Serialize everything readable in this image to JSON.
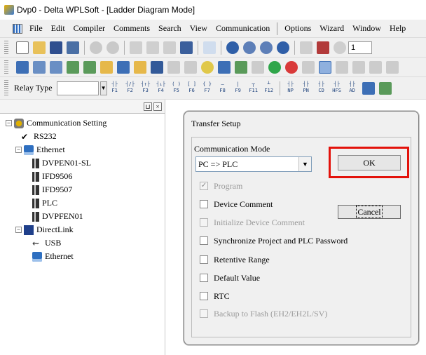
{
  "window": {
    "title": "Dvp0 - Delta WPLSoft - [Ladder Diagram Mode]"
  },
  "menu": [
    "File",
    "Edit",
    "Compiler",
    "Comments",
    "Search",
    "View",
    "Communication",
    "Options",
    "Wizard",
    "Window",
    "Help"
  ],
  "toolbar": {
    "step_value": "1",
    "relay_label": "Relay Type",
    "relay_value": ""
  },
  "function_keys": [
    "F1",
    "F2",
    "F3",
    "F4",
    "F5",
    "F6",
    "F7",
    "F8",
    "F9",
    "F11",
    "F12",
    "NP",
    "PN",
    "CD",
    "HFS",
    "AD"
  ],
  "tree": {
    "root": "Communication Setting",
    "rs232": "RS232",
    "ethernet": "Ethernet",
    "eth_devices": [
      "DVPEN01-SL",
      "IFD9506",
      "IFD9507",
      "PLC",
      "DVPFEN01"
    ],
    "directlink": "DirectLink",
    "usb": "USB",
    "dl_ethernet": "Ethernet"
  },
  "dialog": {
    "title": "Transfer Setup",
    "comm_mode_label": "Communication Mode",
    "comm_mode_value": "PC => PLC",
    "ok_label": "OK",
    "cancel_label": "Cancel",
    "options": [
      {
        "label": "Program",
        "checked": true,
        "enabled": false
      },
      {
        "label": "Device Comment",
        "checked": false,
        "enabled": true
      },
      {
        "label": "Initialize Device Comment",
        "checked": false,
        "enabled": false
      },
      {
        "label": "Synchronize Project and PLC Password",
        "checked": false,
        "enabled": true
      },
      {
        "label": "Retentive Range",
        "checked": false,
        "enabled": true
      },
      {
        "label": "Default Value",
        "checked": false,
        "enabled": true
      },
      {
        "label": "RTC",
        "checked": false,
        "enabled": true
      },
      {
        "label": "Backup to Flash (EH2/EH2L/SV)",
        "checked": false,
        "enabled": false
      }
    ]
  },
  "colors": {
    "highlight": "#e3120b",
    "accent": "#2e6fc0"
  }
}
